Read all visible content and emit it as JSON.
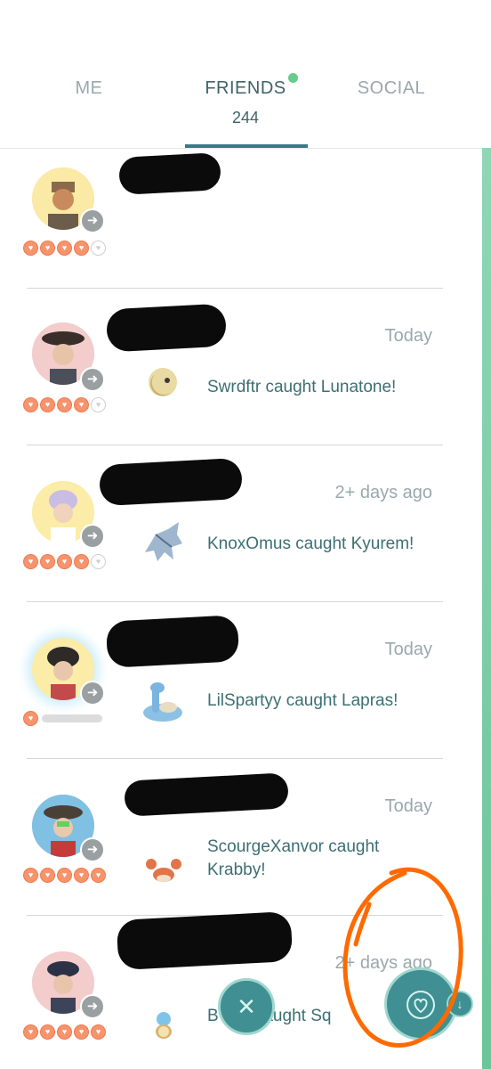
{
  "tabs": {
    "me": "ME",
    "friends": "FRIENDS",
    "friends_count": "244",
    "social": "SOCIAL"
  },
  "friends": [
    {
      "time": "",
      "activity": "",
      "hearts_filled": 4,
      "hearts_total": 5
    },
    {
      "time": "Today",
      "activity": "Swrdftr caught Lunatone!",
      "monster_icon": "lunatone-icon",
      "hearts_filled": 4,
      "hearts_total": 5
    },
    {
      "time": "2+ days ago",
      "activity": "KnoxOmus caught Kyurem!",
      "monster_icon": "kyurem-icon",
      "hearts_filled": 4,
      "hearts_total": 5
    },
    {
      "time": "Today",
      "activity": "LilSpartyy caught Lapras!",
      "monster_icon": "lapras-icon",
      "hearts_filled": 1,
      "hearts_total": 1
    },
    {
      "time": "Today",
      "activity": "ScourgeXanvor caught Krabby!",
      "monster_icon": "krabby-icon",
      "hearts_filled": 5,
      "hearts_total": 5
    },
    {
      "time": "2+ days ago",
      "activity": "B x91 caught Sq",
      "monster_icon": "squirtle-icon",
      "hearts_filled": 5,
      "hearts_total": 5
    }
  ],
  "colors": {
    "accent": "#3f8f93",
    "heart": "#f6946d",
    "annotation": "#ff6a00",
    "online_dot": "#66cc8a"
  }
}
